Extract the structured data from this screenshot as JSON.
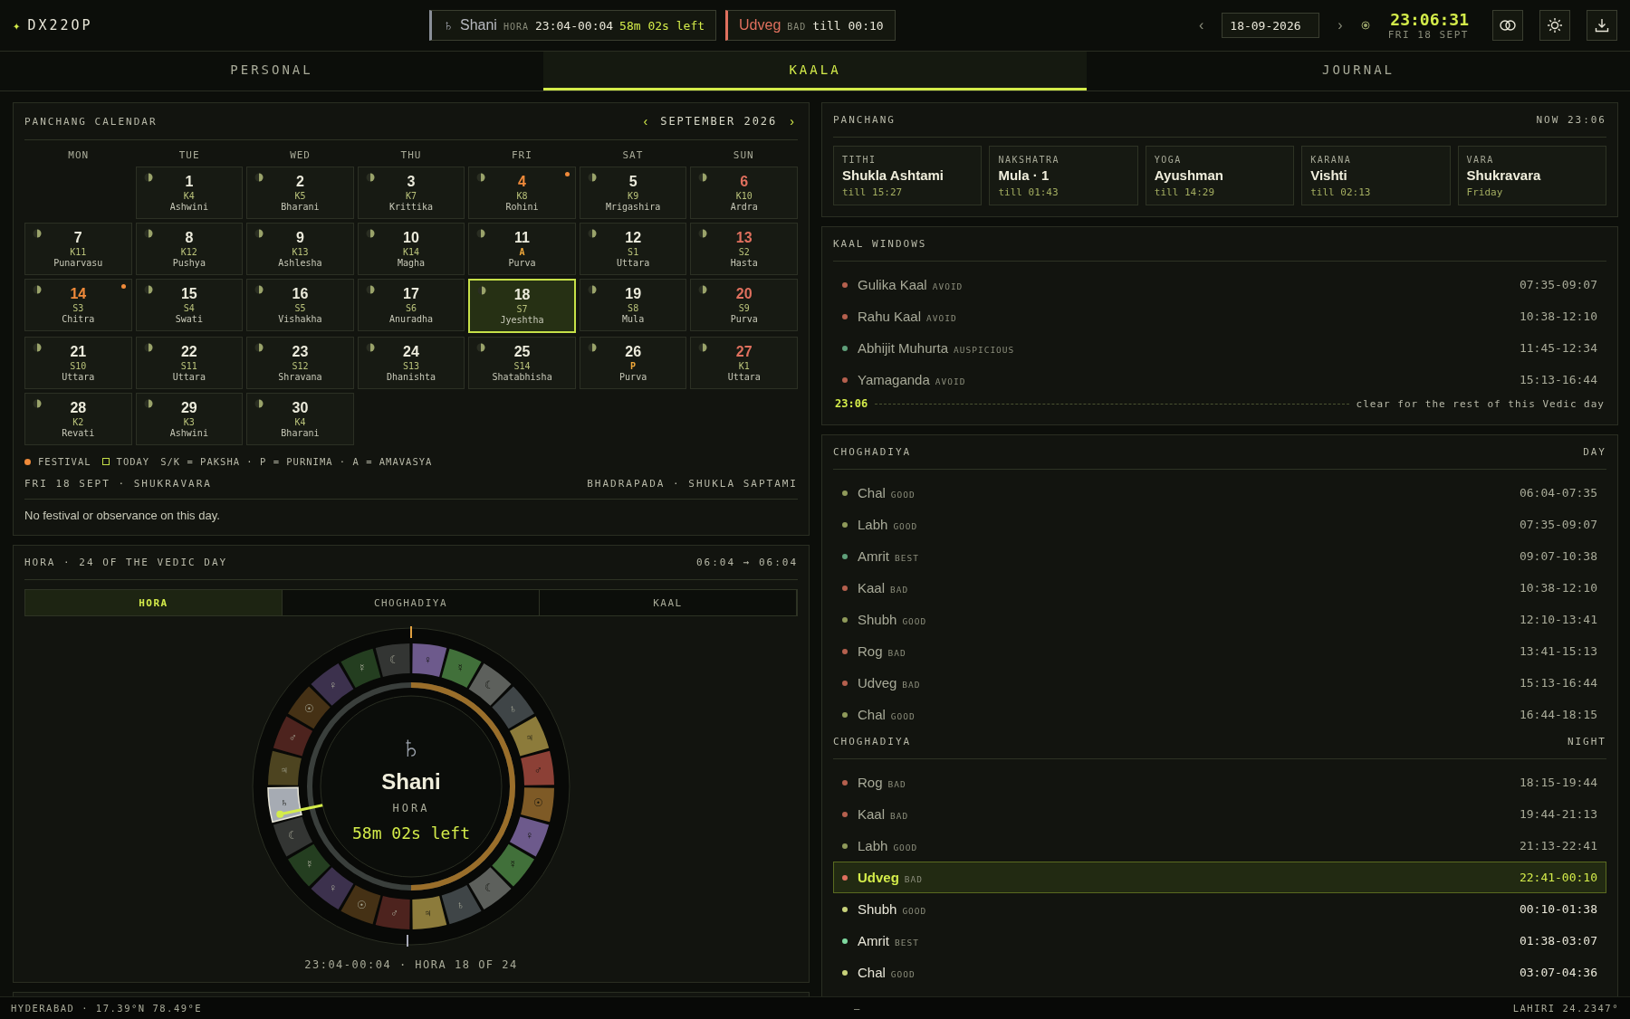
{
  "header": {
    "logo_icon": "✦",
    "logo": "DX22OP",
    "hora_pill": {
      "glyph": "♄",
      "name": "Shani",
      "label": "HORA",
      "range": "23:04-00:04",
      "left": "58m 02s left"
    },
    "chog_pill": {
      "name": "Udveg",
      "label": "BAD",
      "till": "till 00:10"
    },
    "prev": "‹",
    "date": "18-09-2026",
    "next": "›",
    "time": "23:06:31",
    "day": "FRI 18 SEPT"
  },
  "tabs": [
    {
      "label": "PERSONAL",
      "selected": false
    },
    {
      "label": "KAALA",
      "selected": true
    },
    {
      "label": "JOURNAL",
      "selected": false
    }
  ],
  "calendar": {
    "title": "PANCHANG CALENDAR",
    "prev": "‹",
    "month": "SEPTEMBER 2026",
    "next": "›",
    "weekdays": [
      "MON",
      "TUE",
      "WED",
      "THU",
      "FRI",
      "SAT",
      "SUN"
    ],
    "days": [
      {
        "day": "1",
        "code": "K4",
        "nakshatra": "Ashwini",
        "festival": false,
        "marked_code": false,
        "selected": false
      },
      {
        "day": "2",
        "code": "K5",
        "nakshatra": "Bharani",
        "festival": false,
        "marked_code": false,
        "selected": false
      },
      {
        "day": "3",
        "code": "K7",
        "nakshatra": "Krittika",
        "festival": false,
        "marked_code": false,
        "selected": false
      },
      {
        "day": "4",
        "code": "K8",
        "nakshatra": "Rohini",
        "festival": true,
        "marked_code": false,
        "selected": false
      },
      {
        "day": "5",
        "code": "K9",
        "nakshatra": "Mrigashira",
        "festival": false,
        "marked_code": false,
        "selected": false
      },
      {
        "day": "6",
        "code": "K10",
        "nakshatra": "Ardra",
        "festival": false,
        "marked_code": false,
        "selected": false
      },
      {
        "day": "7",
        "code": "K11",
        "nakshatra": "Punarvasu",
        "festival": false,
        "marked_code": false,
        "selected": false
      },
      {
        "day": "8",
        "code": "K12",
        "nakshatra": "Pushya",
        "festival": false,
        "marked_code": false,
        "selected": false
      },
      {
        "day": "9",
        "code": "K13",
        "nakshatra": "Ashlesha",
        "festival": false,
        "marked_code": false,
        "selected": false
      },
      {
        "day": "10",
        "code": "K14",
        "nakshatra": "Magha",
        "festival": false,
        "marked_code": false,
        "selected": false
      },
      {
        "day": "11",
        "code": "A",
        "nakshatra": "Purva",
        "festival": false,
        "marked_code": true,
        "selected": false
      },
      {
        "day": "12",
        "code": "S1",
        "nakshatra": "Uttara",
        "festival": false,
        "marked_code": false,
        "selected": false
      },
      {
        "day": "13",
        "code": "S2",
        "nakshatra": "Hasta",
        "festival": false,
        "marked_code": false,
        "selected": false
      },
      {
        "day": "14",
        "code": "S3",
        "nakshatra": "Chitra",
        "festival": true,
        "marked_code": false,
        "selected": false
      },
      {
        "day": "15",
        "code": "S4",
        "nakshatra": "Swati",
        "festival": false,
        "marked_code": false,
        "selected": false
      },
      {
        "day": "16",
        "code": "S5",
        "nakshatra": "Vishakha",
        "festival": false,
        "marked_code": false,
        "selected": false
      },
      {
        "day": "17",
        "code": "S6",
        "nakshatra": "Anuradha",
        "festival": false,
        "marked_code": false,
        "selected": false
      },
      {
        "day": "18",
        "code": "S7",
        "nakshatra": "Jyeshtha",
        "festival": false,
        "marked_code": false,
        "selected": true
      },
      {
        "day": "19",
        "code": "S8",
        "nakshatra": "Mula",
        "festival": false,
        "marked_code": false,
        "selected": false
      },
      {
        "day": "20",
        "code": "S9",
        "nakshatra": "Purva",
        "festival": false,
        "marked_code": false,
        "selected": false
      },
      {
        "day": "21",
        "code": "S10",
        "nakshatra": "Uttara",
        "festival": false,
        "marked_code": false,
        "selected": false
      },
      {
        "day": "22",
        "code": "S11",
        "nakshatra": "Uttara",
        "festival": false,
        "marked_code": false,
        "selected": false
      },
      {
        "day": "23",
        "code": "S12",
        "nakshatra": "Shravana",
        "festival": false,
        "marked_code": false,
        "selected": false
      },
      {
        "day": "24",
        "code": "S13",
        "nakshatra": "Dhanishta",
        "festival": false,
        "marked_code": false,
        "selected": false
      },
      {
        "day": "25",
        "code": "S14",
        "nakshatra": "Shatabhisha",
        "festival": false,
        "marked_code": false,
        "selected": false
      },
      {
        "day": "26",
        "code": "P",
        "nakshatra": "Purva",
        "festival": false,
        "marked_code": true,
        "selected": false
      },
      {
        "day": "27",
        "code": "K1",
        "nakshatra": "Uttara",
        "festival": false,
        "marked_code": false,
        "selected": false
      },
      {
        "day": "28",
        "code": "K2",
        "nakshatra": "Revati",
        "festival": false,
        "marked_code": false,
        "selected": false
      },
      {
        "day": "29",
        "code": "K3",
        "nakshatra": "Ashwini",
        "festival": false,
        "marked_code": false,
        "selected": false
      },
      {
        "day": "30",
        "code": "K4",
        "nakshatra": "Bharani",
        "festival": false,
        "marked_code": false,
        "selected": false
      }
    ],
    "legend": [
      {
        "kind": "festival",
        "label": "FESTIVAL"
      },
      {
        "kind": "today",
        "label": "TODAY"
      },
      {
        "kind": "text",
        "label": "S/K = PAKSHA · P = PURNIMA · A = AMAVASYA"
      }
    ],
    "day_left": "FRI 18 SEPT · SHUKRAVARA",
    "day_right": "BHADRAPADA · SHUKLA SAPTAMI",
    "note": "No festival or observance on this day."
  },
  "hora": {
    "title": "HORA · 24 OF THE VEDIC DAY",
    "span": "06:04 → 06:04",
    "tabs": [
      {
        "label": "HORA",
        "selected": true
      },
      {
        "label": "CHOGHADIYA",
        "selected": false
      },
      {
        "label": "KAAL",
        "selected": false
      }
    ],
    "segments": [
      {
        "glyph": "♀",
        "color": "#6d5a8c",
        "selected": false
      },
      {
        "glyph": "☿",
        "color": "#41703a",
        "selected": false
      },
      {
        "glyph": "☾",
        "color": "#5d605c",
        "selected": false
      },
      {
        "glyph": "♄",
        "color": "#3f4547",
        "selected": false
      },
      {
        "glyph": "♃",
        "color": "#8c7b3b",
        "selected": false
      },
      {
        "glyph": "♂",
        "color": "#8c4036",
        "selected": false
      },
      {
        "glyph": "☉",
        "color": "#7e5a26",
        "selected": false
      },
      {
        "glyph": "♀",
        "color": "#6d5a8c",
        "selected": false
      },
      {
        "glyph": "☿",
        "color": "#41703a",
        "selected": false
      },
      {
        "glyph": "☾",
        "color": "#5d605c",
        "selected": false
      },
      {
        "glyph": "♄",
        "color": "#3f4547",
        "selected": false
      },
      {
        "glyph": "♃",
        "color": "#8c7b3b",
        "selected": false
      },
      {
        "glyph": "♂",
        "color": "#4d231e",
        "selected": false
      },
      {
        "glyph": "☉",
        "color": "#453115",
        "selected": false
      },
      {
        "glyph": "♀",
        "color": "#3c314d",
        "selected": false
      },
      {
        "glyph": "☿",
        "color": "#243e20",
        "selected": false
      },
      {
        "glyph": "☾",
        "color": "#333533",
        "selected": false
      },
      {
        "glyph": "♄",
        "color": "#a6abb3",
        "selected": true
      },
      {
        "glyph": "♃",
        "color": "#4d4420",
        "selected": false
      },
      {
        "glyph": "♂",
        "color": "#4d231e",
        "selected": false
      },
      {
        "glyph": "☉",
        "color": "#453115",
        "selected": false
      },
      {
        "glyph": "♀",
        "color": "#3c314d",
        "selected": false
      },
      {
        "glyph": "☿",
        "color": "#243e20",
        "selected": false
      },
      {
        "glyph": "☾",
        "color": "#333533",
        "selected": false
      }
    ],
    "center": {
      "glyph": "♄",
      "name": "Shani",
      "label": "HORA",
      "left": "58m 02s left"
    },
    "footer": "23:04-00:04 · HORA 18 OF 24"
  },
  "panchang": {
    "title": "PANCHANG",
    "now": "NOW 23:06",
    "cards": [
      {
        "label": "TITHI",
        "value": "Shukla Ashtami",
        "sub": "till 15:27"
      },
      {
        "label": "NAKSHATRA",
        "value": "Mula · 1",
        "sub": "till 01:43"
      },
      {
        "label": "YOGA",
        "value": "Ayushman",
        "sub": "till 14:29"
      },
      {
        "label": "KARANA",
        "value": "Vishti",
        "sub": "till 02:13"
      },
      {
        "label": "VARA",
        "value": "Shukravara",
        "sub": "Friday"
      }
    ]
  },
  "kaal": {
    "title": "KAAL WINDOWS",
    "rows": [
      {
        "name": "Gulika Kaal",
        "quality": "AVOID",
        "time": "07:35-09:07",
        "color": "#b5604e",
        "past": true
      },
      {
        "name": "Rahu Kaal",
        "quality": "AVOID",
        "time": "10:38-12:10",
        "color": "#b5604e",
        "past": true
      },
      {
        "name": "Abhijit Muhurta",
        "quality": "AUSPICIOUS",
        "time": "11:45-12:34",
        "color": "#5fa07a",
        "past": true
      },
      {
        "name": "Yamaganda",
        "quality": "AVOID",
        "time": "15:13-16:44",
        "color": "#b5604e",
        "past": true
      }
    ],
    "now_time": "23:06",
    "now_note": "clear for the rest of this Vedic day"
  },
  "choghadiya": [
    {
      "title": "CHOGHADIYA",
      "period": "DAY",
      "rows": [
        {
          "name": "Chal",
          "quality": "GOOD",
          "time": "06:04-07:35",
          "color": "#8f9a5a",
          "past": true,
          "selected": false
        },
        {
          "name": "Labh",
          "quality": "GOOD",
          "time": "07:35-09:07",
          "color": "#8f9a5a",
          "past": true,
          "selected": false
        },
        {
          "name": "Amrit",
          "quality": "BEST",
          "time": "09:07-10:38",
          "color": "#5fa07a",
          "past": true,
          "selected": false
        },
        {
          "name": "Kaal",
          "quality": "BAD",
          "time": "10:38-12:10",
          "color": "#b5604e",
          "past": true,
          "selected": false
        },
        {
          "name": "Shubh",
          "quality": "GOOD",
          "time": "12:10-13:41",
          "color": "#8f9a5a",
          "past": true,
          "selected": false
        },
        {
          "name": "Rog",
          "quality": "BAD",
          "time": "13:41-15:13",
          "color": "#b5604e",
          "past": true,
          "selected": false
        },
        {
          "name": "Udveg",
          "quality": "BAD",
          "time": "15:13-16:44",
          "color": "#b5604e",
          "past": true,
          "selected": false
        },
        {
          "name": "Chal",
          "quality": "GOOD",
          "time": "16:44-18:15",
          "color": "#8f9a5a",
          "past": true,
          "selected": false
        }
      ]
    },
    {
      "title": "CHOGHADIYA",
      "period": "NIGHT",
      "rows": [
        {
          "name": "Rog",
          "quality": "BAD",
          "time": "18:15-19:44",
          "color": "#b5604e",
          "past": true,
          "selected": false
        },
        {
          "name": "Kaal",
          "quality": "BAD",
          "time": "19:44-21:13",
          "color": "#b5604e",
          "past": true,
          "selected": false
        },
        {
          "name": "Labh",
          "quality": "GOOD",
          "time": "21:13-22:41",
          "color": "#8f9a5a",
          "past": true,
          "selected": false
        },
        {
          "name": "Udveg",
          "quality": "BAD",
          "time": "22:41-00:10",
          "color": "#e0705e",
          "past": false,
          "selected": true
        },
        {
          "name": "Shubh",
          "quality": "GOOD",
          "time": "00:10-01:38",
          "color": "#c8d27a",
          "past": false,
          "selected": false
        },
        {
          "name": "Amrit",
          "quality": "BEST",
          "time": "01:38-03:07",
          "color": "#7fd9a0",
          "past": false,
          "selected": false
        },
        {
          "name": "Chal",
          "quality": "GOOD",
          "time": "03:07-04:36",
          "color": "#c8d27a",
          "past": false,
          "selected": false
        }
      ]
    }
  ],
  "status": {
    "left": "HYDERABAD · 17.39°N 78.49°E",
    "center": "–",
    "right": "LAHIRI 24.2347°"
  }
}
